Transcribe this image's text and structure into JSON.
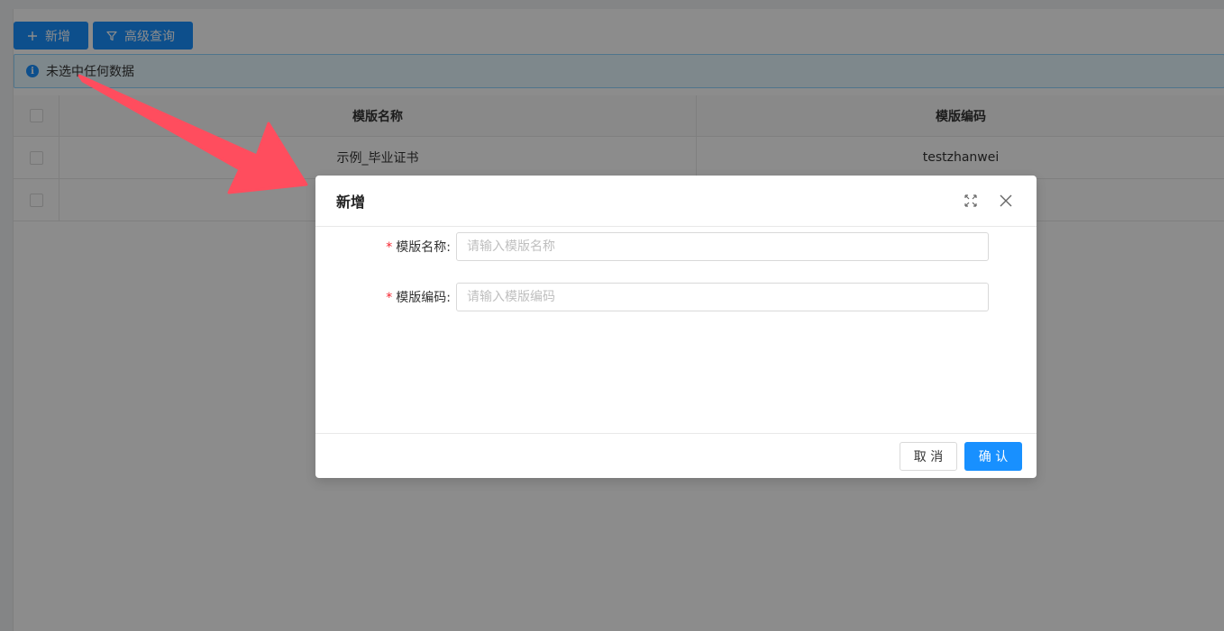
{
  "toolbar": {
    "add_label": "新增",
    "query_label": "高级查询"
  },
  "alert": {
    "text": "未选中任何数据"
  },
  "table": {
    "headers": [
      "模版名称",
      "模版编码"
    ],
    "rows": [
      {
        "name": "示例_毕业证书",
        "code": "testzhanwei"
      },
      {
        "name": "",
        "code": ""
      }
    ]
  },
  "modal": {
    "title": "新增",
    "fields": [
      {
        "label": "模版名称",
        "colon": ":",
        "placeholder": "请输入模版名称",
        "value": ""
      },
      {
        "label": "模版编码",
        "colon": ":",
        "placeholder": "请输入模版编码",
        "value": ""
      }
    ],
    "cancel_label": "取 消",
    "ok_label": "确 认"
  },
  "colors": {
    "primary": "#1890ff",
    "required": "#f5222d",
    "arrow": "#ff4d5e"
  },
  "icons": {
    "add": "plus-icon",
    "query": "filter-icon",
    "info": "info-circle-icon",
    "fullscreen": "fullscreen-icon",
    "close": "close-icon"
  }
}
